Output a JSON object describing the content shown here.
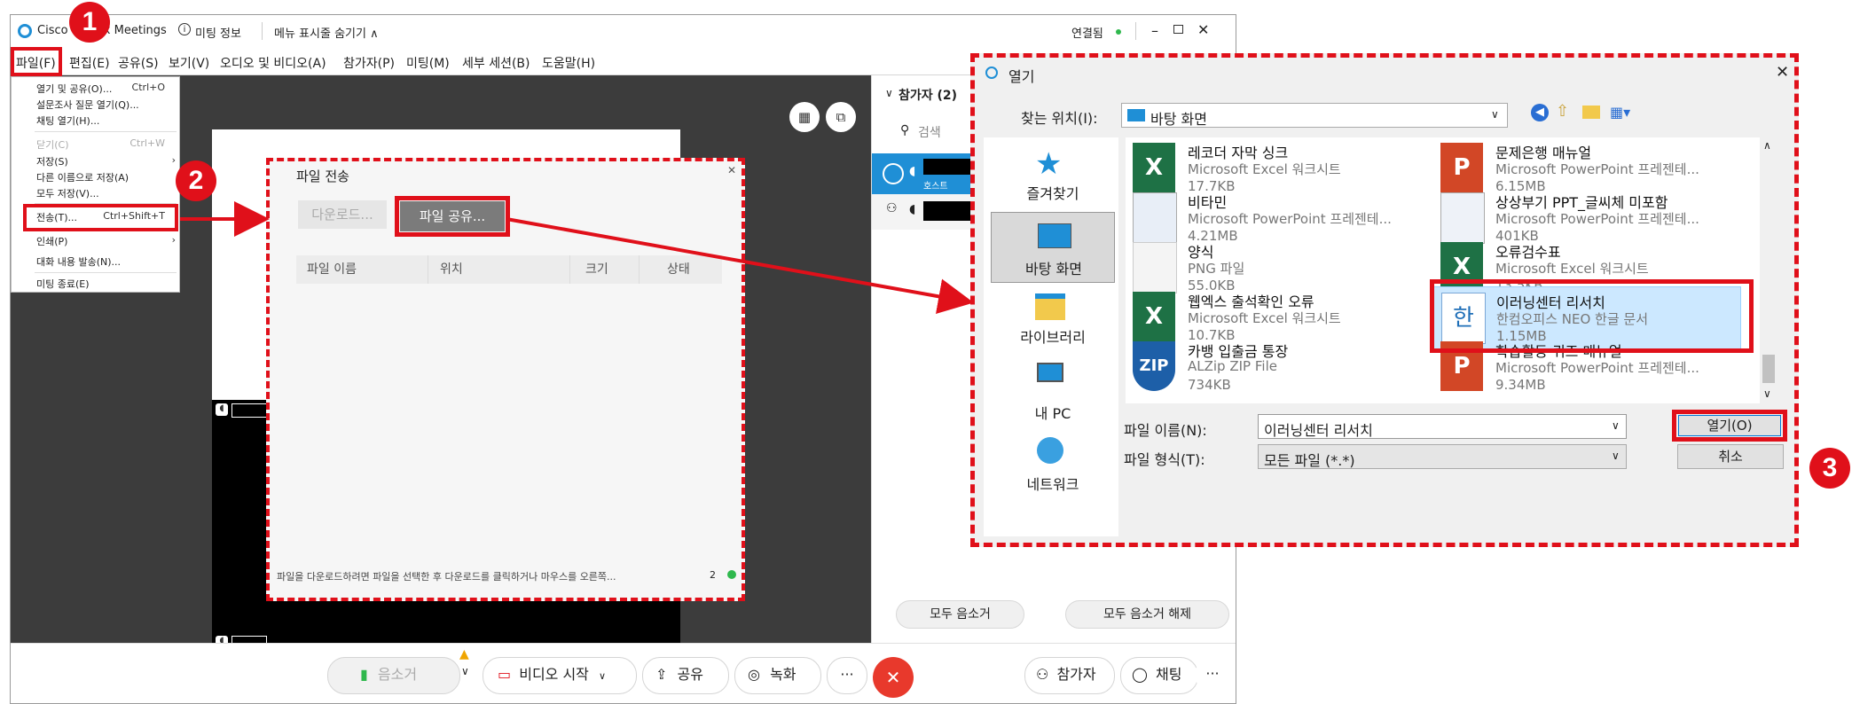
{
  "webex": {
    "app_title": "Cisco Webex Meetings",
    "meeting_info": "미팅 정보",
    "hide_menu": "메뉴 표시줄 숨기기 ∧",
    "connection": "연결됨",
    "menu": [
      "파일(F)",
      "편집(E)",
      "공유(S)",
      "보기(V)",
      "오디오 및 비디오(A)",
      "참가자(P)",
      "미팅(M)",
      "세부 세션(B)",
      "도움말(H)"
    ]
  },
  "file_menu": {
    "items": [
      {
        "label": "열기 및 공유(O)...",
        "shortcut": "Ctrl+O"
      },
      {
        "label": "설문조사 질문 열기(Q)...",
        "shortcut": ""
      },
      {
        "label": "채팅 열기(H)...",
        "shortcut": ""
      },
      {
        "label": "닫기(C)",
        "shortcut": "Ctrl+W"
      },
      {
        "label": "저장(S)",
        "shortcut": ""
      },
      {
        "label": "다른 이름으로 저장(A)",
        "shortcut": ""
      },
      {
        "label": "모두 저장(V)...",
        "shortcut": ""
      },
      {
        "label": "전송(T)...",
        "shortcut": "Ctrl+Shift+T"
      },
      {
        "label": "인쇄(P)",
        "shortcut": ""
      },
      {
        "label": "대화 내용 발송(N)...",
        "shortcut": ""
      },
      {
        "label": "미팅 종료(E)",
        "shortcut": ""
      }
    ]
  },
  "participants": {
    "header": "참가자 (2)",
    "search_placeholder": "검색",
    "host_label": "호스트",
    "mute_all": "모두 음소거",
    "unmute_all": "모두 음소거 해제"
  },
  "controls": {
    "mute": "음소거",
    "video": "비디오 시작",
    "share": "공유",
    "record": "녹화",
    "more": "···",
    "participants": "참가자",
    "chat": "채팅"
  },
  "transfer": {
    "title": "파일 전송",
    "download": "다운로드...",
    "share_file": "파일 공유...",
    "columns": [
      "파일 이름",
      "위치",
      "크기",
      "상태"
    ],
    "status_text": "파일을 다운로드하려면 파일을 선택한 후 다운로드를 클릭하거나 마우스를 오른쪽...",
    "count": "2"
  },
  "open_dialog": {
    "title": "열기",
    "look_in_label": "찾는 위치(I):",
    "look_in_value": "바탕 화면",
    "sidebar": [
      "즐겨찾기",
      "바탕 화면",
      "라이브러리",
      "내 PC",
      "네트워크"
    ],
    "files": [
      {
        "name": "레코더 자막 싱크",
        "type": "Microsoft Excel 워크시트",
        "size": "17.7KB",
        "icon": "excel"
      },
      {
        "name": "문제은행 매뉴얼",
        "type": "Microsoft PowerPoint 프레젠테...",
        "size": "6.15MB",
        "icon": "ppt"
      },
      {
        "name": "비타민",
        "type": "Microsoft PowerPoint 프레젠테...",
        "size": "4.21MB",
        "icon": "ppt-thumb"
      },
      {
        "name": "상상부기 PPT_글씨체 미포함",
        "type": "Microsoft PowerPoint 프레젠테...",
        "size": "401KB",
        "icon": "ppt-thumb"
      },
      {
        "name": "양식",
        "type": "PNG 파일",
        "size": "55.0KB",
        "icon": "png"
      },
      {
        "name": "오류검수표",
        "type": "Microsoft Excel 워크시트",
        "size": "13.5KB",
        "icon": "excel"
      },
      {
        "name": "웹엑스 출석확인 오류",
        "type": "Microsoft Excel 워크시트",
        "size": "10.7KB",
        "icon": "excel"
      },
      {
        "name": "이러닝센터 리서치",
        "type": "한컴오피스 NEO 한글 문서",
        "size": "1.15MB",
        "icon": "hwp"
      },
      {
        "name": "카뱅 입출금 통장",
        "type": "ALZip ZIP File",
        "size": "734KB",
        "icon": "zip"
      },
      {
        "name": "학습활동 퀴즈 매뉴얼",
        "type": "Microsoft PowerPoint 프레젠테...",
        "size": "9.34MB",
        "icon": "ppt"
      }
    ],
    "filename_label": "파일 이름(N):",
    "filename_value": "이러닝센터 리서치",
    "filetype_label": "파일 형식(T):",
    "filetype_value": "모든 파일 (*.*)",
    "open_button": "열기(O)",
    "cancel_button": "취소"
  },
  "badges": [
    "1",
    "2",
    "3"
  ],
  "colors": {
    "accent_red": "#e0101a",
    "webex_blue": "#1f8fd6",
    "selection": "#cce8ff"
  }
}
